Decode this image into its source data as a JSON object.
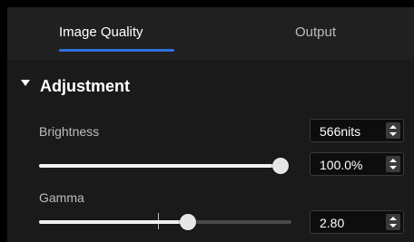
{
  "tabs": [
    {
      "label": "Image Quality",
      "active": true
    },
    {
      "label": "Output",
      "active": false
    }
  ],
  "section": {
    "title": "Adjustment",
    "icon": "caret-down-icon"
  },
  "brightness": {
    "label": "Brightness",
    "nits_value": "566nits",
    "percent_value": "100.0%",
    "slider_level": 1.0
  },
  "gamma": {
    "label": "Gamma",
    "value": "2.80",
    "slider_level": 0.59
  },
  "colors": {
    "accent": "#2f6fe0",
    "panel_bg": "#1a1a1a",
    "input_bg": "#0d0d0d"
  }
}
